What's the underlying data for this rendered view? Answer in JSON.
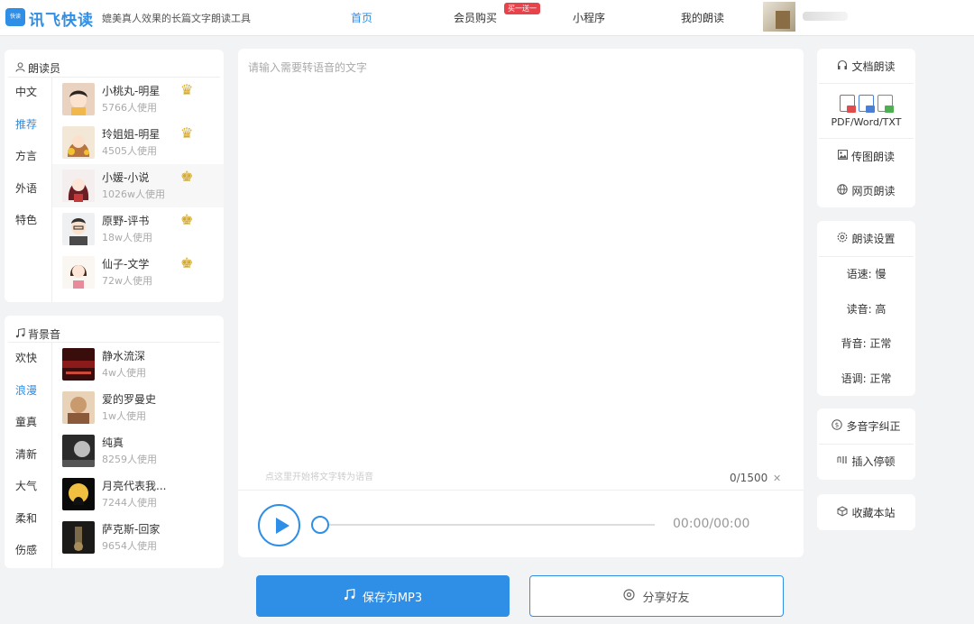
{
  "header": {
    "logo_badge": "快读",
    "logo_text": "讯飞快读",
    "slogan": "媲美真人效果的长篇文字朗读工具",
    "nav": {
      "home": "首页",
      "vip": "会员购买",
      "vip_badge": "买一送一",
      "mini": "小程序",
      "mine": "我的朗读"
    }
  },
  "reader": {
    "title": "朗读员",
    "icon": "person-icon",
    "categories": [
      "中文",
      "推荐",
      "方言",
      "外语",
      "特色"
    ],
    "active_category": "推荐",
    "voices": [
      {
        "name": "小桃丸-明星",
        "count": "5766人使用",
        "crown": "gold"
      },
      {
        "name": "玲姐姐-明星",
        "count": "4505人使用",
        "crown": "gold"
      },
      {
        "name": "小媛-小说",
        "count": "1026w人使用",
        "crown": "gold-2"
      },
      {
        "name": "原野-评书",
        "count": "18w人使用",
        "crown": "gold-2"
      },
      {
        "name": "仙子-文学",
        "count": "72w人使用",
        "crown": "gold-2"
      }
    ]
  },
  "bgm": {
    "title": "背景音",
    "icon": "music-note-icon",
    "categories": [
      "欢快",
      "浪漫",
      "童真",
      "清新",
      "大气",
      "柔和",
      "伤感"
    ],
    "active_category": "浪漫",
    "tracks": [
      {
        "name": "静水流深",
        "count": "4w人使用"
      },
      {
        "name": "爱的罗曼史",
        "count": "1w人使用"
      },
      {
        "name": "纯真",
        "count": "8259人使用"
      },
      {
        "name": "月亮代表我...",
        "count": "7244人使用"
      },
      {
        "name": "萨克斯-回家",
        "count": "9654人使用"
      }
    ]
  },
  "editor": {
    "placeholder": "请输入需要转语音的文字",
    "hint": "点这里开始将文字转为语音",
    "char_count": "0/1500",
    "clear_icon": "close-icon"
  },
  "player": {
    "time": "00:00/00:00",
    "progress": 0
  },
  "actions": {
    "save": "保存为MP3",
    "share": "分享好友"
  },
  "side": {
    "doc_read": "文档朗读",
    "file_types": "PDF/Word/TXT",
    "image_read": "传图朗读",
    "web_read": "网页朗读",
    "settings_title": "朗读设置",
    "speed": "语速: 慢",
    "pitch": "读音: 高",
    "bg_volume": "背音: 正常",
    "tone": "语调: 正常",
    "polyphone": "多音字纠正",
    "pause": "插入停顿",
    "bookmark": "收藏本站"
  },
  "colors": {
    "accent": "#2f8ee6",
    "badge": "#e8424b",
    "crown": "#d4a82a"
  }
}
